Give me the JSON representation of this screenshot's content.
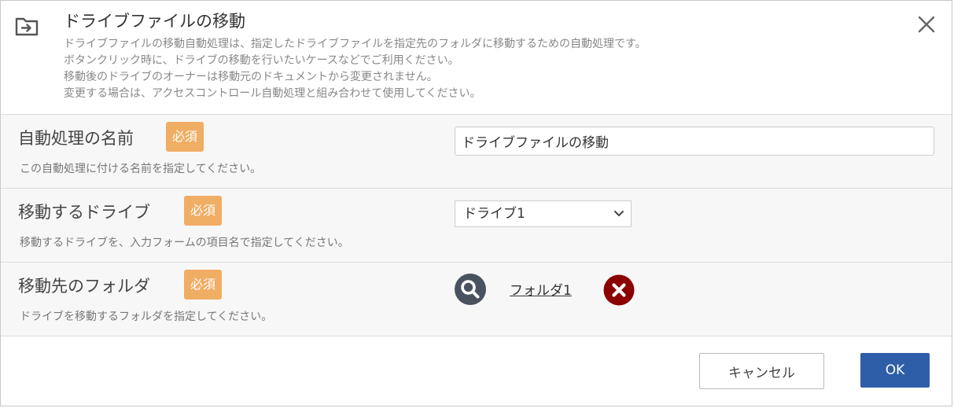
{
  "dialog": {
    "title": "ドライブファイルの移動",
    "description": [
      "ドライブファイルの移動自動処理は、指定したドライブファイルを指定先のフォルダに移動するための自動処理です。",
      "ボタンクリック時に、ドライブの移動を行いたいケースなどでご利用ください。",
      "移動後のドライブのオーナーは移動元のドキュメントから変更されません。",
      "変更する場合は、アクセスコントロール自動処理と組み合わせて使用してください。"
    ]
  },
  "fields": {
    "name": {
      "label": "自動処理の名前",
      "badge": "必須",
      "help": "この自動処理に付ける名前を指定してください。",
      "value": "ドライブファイルの移動"
    },
    "drive": {
      "label": "移動するドライブ",
      "badge": "必須",
      "help": "移動するドライブを、入力フォームの項目名で指定してください。",
      "selected": "ドライブ1"
    },
    "folder": {
      "label": "移動先のフォルダ",
      "badge": "必須",
      "help": "ドライブを移動するフォルダを指定してください。",
      "value": "フォルダ1"
    }
  },
  "footer": {
    "cancel_label": "キャンセル",
    "ok_label": "OK"
  },
  "icons": {
    "header": "folder-move-icon",
    "close": "close-icon",
    "search": "search-icon",
    "clear": "clear-icon",
    "dropdown": "chevron-down-icon"
  },
  "colors": {
    "badge": "#f0ad64",
    "ok_button": "#2e5ea8",
    "clear_icon": "#8b0000",
    "search_icon": "#4a5260"
  }
}
